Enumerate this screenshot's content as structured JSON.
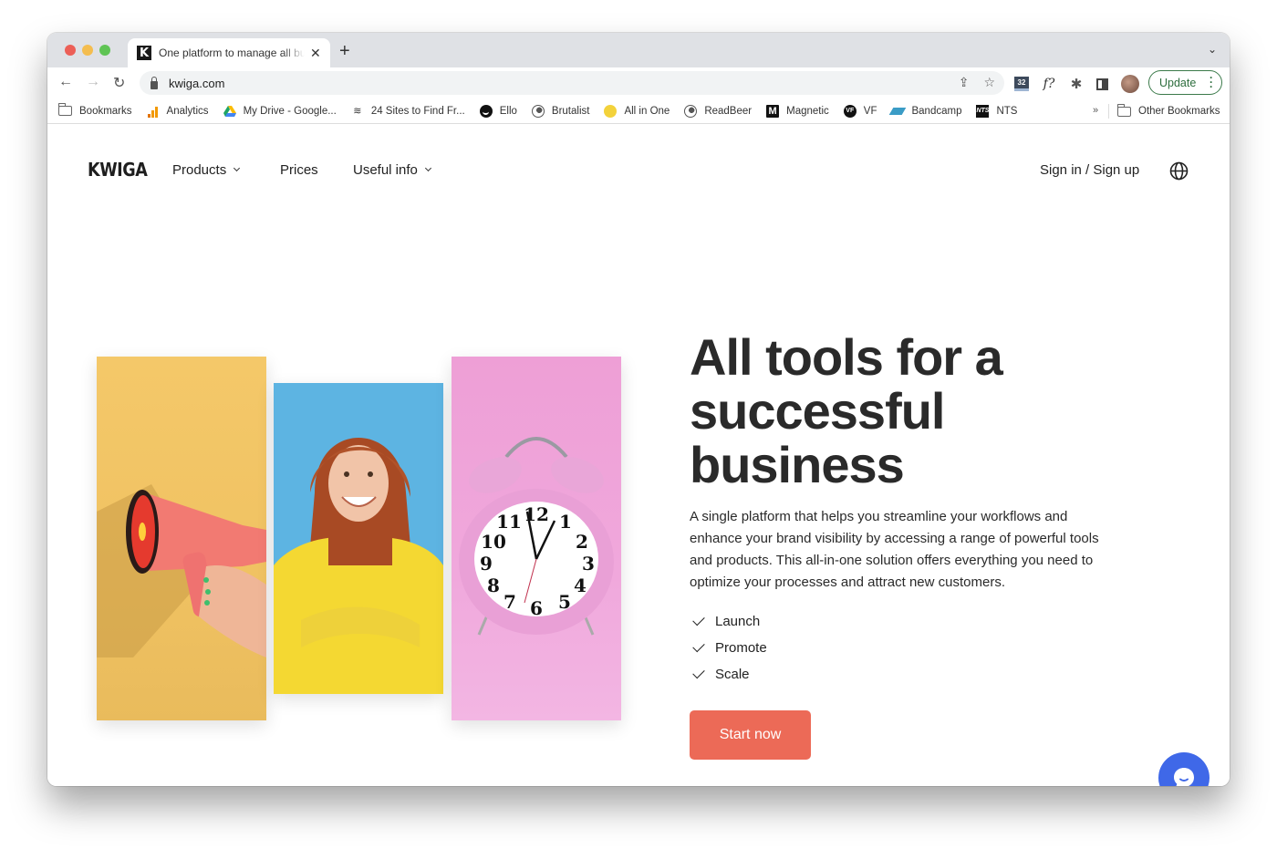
{
  "browser": {
    "tab": {
      "title": "One platform to manage all business",
      "favicon": "K"
    },
    "new_tab_label": "+",
    "url": "kwiga.com",
    "update_label": "Update",
    "extensions": [
      {
        "name": "counter-extension",
        "label": "32"
      },
      {
        "name": "font-identifier-extension",
        "label": "f?"
      },
      {
        "name": "extensions-puzzle",
        "label": ""
      },
      {
        "name": "side-panel",
        "label": ""
      },
      {
        "name": "profile-avatar",
        "label": ""
      }
    ],
    "bookmarks": [
      {
        "label": "Bookmarks",
        "icon": "folder-icon"
      },
      {
        "label": "Analytics",
        "icon": "analytics-icon"
      },
      {
        "label": "My Drive - Google...",
        "icon": "google-drive-icon"
      },
      {
        "label": "24 Sites to Find Fr...",
        "icon": "stack-icon"
      },
      {
        "label": "Ello",
        "icon": "ello-icon"
      },
      {
        "label": "Brutalist",
        "icon": "globe-icon"
      },
      {
        "label": "All in One",
        "icon": "all-in-one-icon"
      },
      {
        "label": "ReadBeer",
        "icon": "globe-icon"
      },
      {
        "label": "Magnetic",
        "icon": "magnetic-m-icon"
      },
      {
        "label": "VF",
        "icon": "vf-icon"
      },
      {
        "label": "Bandcamp",
        "icon": "bandcamp-icon"
      },
      {
        "label": "NTS",
        "icon": "nts-icon"
      }
    ],
    "bookmarks_overflow": "»",
    "other_bookmarks": "Other Bookmarks"
  },
  "site": {
    "logo": "KWIGA",
    "nav": {
      "products": "Products",
      "prices": "Prices",
      "useful_info": "Useful info"
    },
    "signin": "Sign in / Sign up",
    "hero": {
      "title": "All tools for a successful business",
      "description": "A single platform that helps you streamline your workflows and enhance your brand visibility by accessing a range of powerful tools and products. This all-in-one solution offers everything you need to optimize your processes and attract new customers.",
      "features": [
        "Launch",
        "Promote",
        "Scale"
      ],
      "cta": "Start now",
      "images": [
        {
          "name": "megaphone-image",
          "bg": "#f2c566"
        },
        {
          "name": "smiling-woman-image",
          "bg": "#5db4e2"
        },
        {
          "name": "alarm-clock-image",
          "bg": "#ef a3d9"
        }
      ]
    },
    "colors": {
      "cta": "#ec6a57",
      "chat": "#3f68e8",
      "update_green": "#2e6e3e"
    }
  }
}
